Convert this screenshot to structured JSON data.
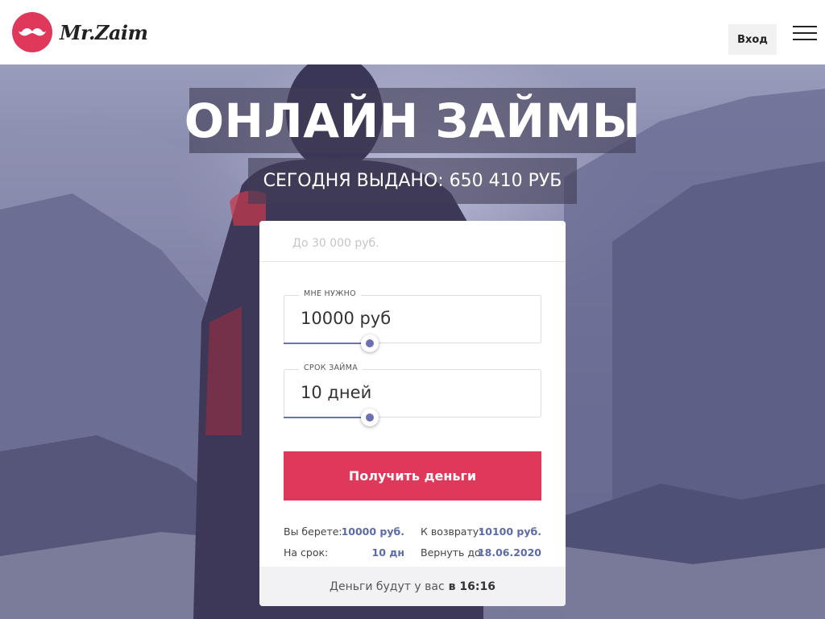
{
  "header": {
    "logo_text": "Mr.Zaim",
    "login_label": "Вход"
  },
  "hero": {
    "title": "ОНЛАЙН ЗАЙМЫ",
    "subtitle": "СЕГОДНЯ ВЫДАНО: 650 410 РУБ"
  },
  "calculator": {
    "limit_text": "До 30 000 руб.",
    "amount": {
      "label": "МНЕ НУЖНО",
      "value": "10000 руб",
      "slider_value": 10000,
      "slider_max": 30000
    },
    "term": {
      "label": "СРОК ЗАЙМА",
      "value": "10 дней",
      "slider_value": 10
    },
    "cta_label": "Получить деньги",
    "summary": {
      "borrow_label": "Вы берете:",
      "borrow_value": "10000 руб.",
      "repay_label": "К возврату:",
      "repay_value": "10100 руб.",
      "term_label": "На срок:",
      "term_value": "10 дн",
      "return_label": "Вернуть до:",
      "return_value": "18.06.2020"
    },
    "footer_text": "Деньги будут у вас",
    "footer_time": "в 16:16"
  },
  "colors": {
    "brand_red": "#e0385a",
    "accent_blue": "#6b71b3",
    "hero_purple": "#5a5b82"
  },
  "icons": {
    "logo": "mustache-icon",
    "menu": "hamburger-menu-icon",
    "slider": "slider-thumb-icon"
  }
}
